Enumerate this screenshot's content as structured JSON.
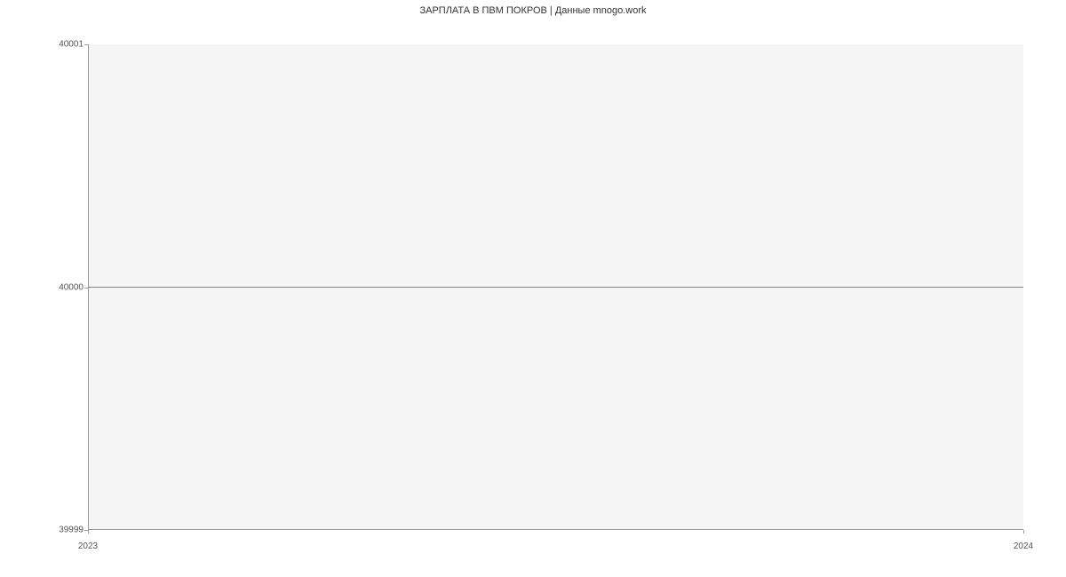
{
  "title": "ЗАРПЛАТА В ПВМ ПОКРОВ | Данные mnogo.work",
  "y_ticks": [
    "39999",
    "40000",
    "40001"
  ],
  "x_ticks": [
    "2023",
    "2024"
  ],
  "chart_data": {
    "type": "line",
    "title": "ЗАРПЛАТА В ПВМ ПОКРОВ | Данные mnogo.work",
    "xlabel": "",
    "ylabel": "",
    "xlim": [
      2023,
      2024
    ],
    "ylim": [
      39999,
      40001
    ],
    "x": [
      2023,
      2024
    ],
    "values": [
      40000,
      40000
    ],
    "series_color": "#4a90e2"
  }
}
